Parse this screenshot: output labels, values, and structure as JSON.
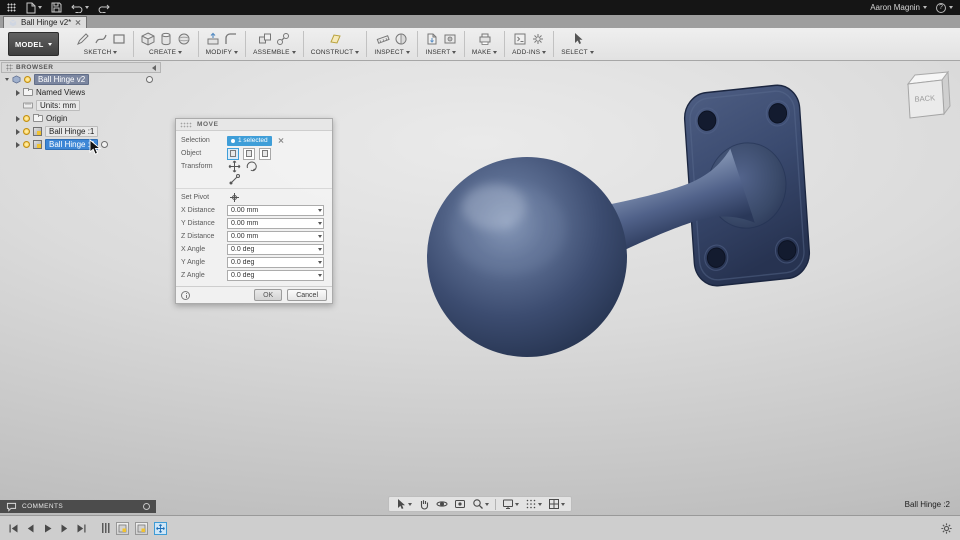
{
  "app_bar": {
    "user_label": "Aaron Magnin",
    "help_glyph": "?"
  },
  "document_tab": {
    "title": "Ball Hinge v2*"
  },
  "toolbar": {
    "workspace_label": "MODEL",
    "groups": [
      {
        "label": "SKETCH"
      },
      {
        "label": "CREATE"
      },
      {
        "label": "MODIFY"
      },
      {
        "label": "ASSEMBLE"
      },
      {
        "label": "CONSTRUCT"
      },
      {
        "label": "INSPECT"
      },
      {
        "label": "INSERT"
      },
      {
        "label": "MAKE"
      },
      {
        "label": "ADD-INS"
      },
      {
        "label": "SELECT"
      }
    ]
  },
  "browser": {
    "header_label": "BROWSER",
    "root_label": "Ball Hinge v2",
    "items": [
      {
        "label": "Named Views"
      },
      {
        "label": "Units: mm"
      },
      {
        "label": "Origin"
      },
      {
        "label": "Ball Hinge :1"
      },
      {
        "label": "Ball Hinge :2"
      }
    ]
  },
  "move_dialog": {
    "title": "MOVE",
    "selection_label": "Selection",
    "selection_chip": "1 selected",
    "object_label": "Object",
    "transform_label": "Transform",
    "set_pivot_label": "Set Pivot",
    "fields": [
      {
        "label": "X Distance",
        "value": "0.00 mm"
      },
      {
        "label": "Y Distance",
        "value": "0.00 mm"
      },
      {
        "label": "Z Distance",
        "value": "0.00 mm"
      },
      {
        "label": "X Angle",
        "value": "0.0 deg"
      },
      {
        "label": "Y Angle",
        "value": "0.0 deg"
      },
      {
        "label": "Z Angle",
        "value": "0.0 deg"
      }
    ],
    "ok_label": "OK",
    "cancel_label": "Cancel"
  },
  "viewcube": {
    "face_label": "BACK"
  },
  "comments": {
    "label": "COMMENTS"
  },
  "status": {
    "active_component": "Ball Hinge :2"
  },
  "colors": {
    "accent_blue": "#3d9bd5",
    "selection_blue": "#3e87d6",
    "model_base": "#36466a",
    "model_highlight": "#8496b6",
    "model_shadow": "#1f2b45"
  }
}
